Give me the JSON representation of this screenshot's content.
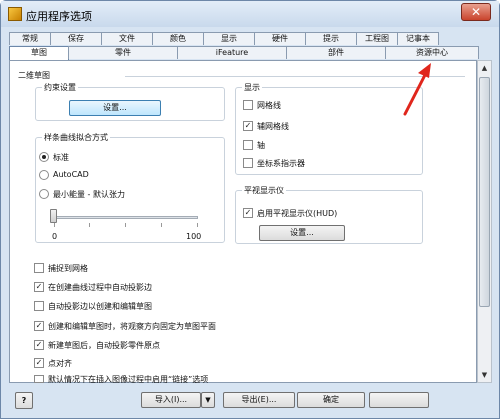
{
  "window": {
    "title": "应用程序选项",
    "close_glyph": "✕"
  },
  "tabs_row1": [
    "常规",
    "保存",
    "文件",
    "颜色",
    "显示",
    "硬件",
    "提示",
    "工程图",
    "记事本"
  ],
  "tabs_row2": [
    "草图",
    "零件",
    "iFeature",
    "部件",
    "资源中心"
  ],
  "section_title": "二维草图",
  "constraint": {
    "title": "约束设置",
    "button": "设置..."
  },
  "spline": {
    "title": "样条曲线拟合方式",
    "options": [
      "标准",
      "AutoCAD",
      "最小能量 - 默认张力"
    ],
    "slider_min": "0",
    "slider_max": "100"
  },
  "display": {
    "title": "显示",
    "items": [
      {
        "label": "网格线",
        "checked": false
      },
      {
        "label": "辅网格线",
        "checked": true
      },
      {
        "label": "轴",
        "checked": false
      },
      {
        "label": "坐标系指示器",
        "checked": false
      }
    ]
  },
  "heads_up": {
    "title": "平视显示仪",
    "item": {
      "label": "启用平视显示仪(HUD)",
      "checked": true
    },
    "button": "设置..."
  },
  "options": [
    {
      "label": "捕捉到网格",
      "checked": false
    },
    {
      "label": "在创建曲线过程中自动投影边",
      "checked": true
    },
    {
      "label": "自动投影边以创建和编辑草图",
      "checked": false
    },
    {
      "label": "创建和编辑草图时，将观察方向固定为草图平面",
      "checked": true
    },
    {
      "label": "新建草图后，自动投影零件原点",
      "checked": true
    },
    {
      "label": "点对齐",
      "checked": true
    },
    {
      "label": "默认情况下在插入图像过程中启用“链接”选项",
      "checked": false
    }
  ],
  "footer": {
    "help": "?",
    "import": "导入(I)...",
    "export": "导出(E)...",
    "ok": "确定",
    "dropdown_glyph": "▼"
  },
  "icons": [
    "app-icon",
    "close-icon",
    "help-icon",
    "dropdown-arrow-icon",
    "scroll-up-icon",
    "scroll-down-icon"
  ],
  "colors": {
    "annotation_arrow": "#e0261c",
    "window_frame": "#d7e4f2"
  }
}
